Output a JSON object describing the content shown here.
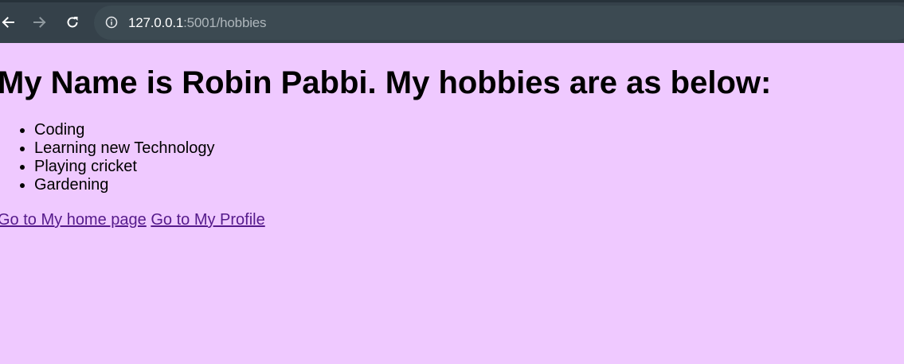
{
  "browser": {
    "url_host": "127.0.0.1",
    "url_rest": ":5001/hobbies"
  },
  "page": {
    "title": "My Name is Robin Pabbi. My hobbies are as below:",
    "hobbies": [
      "Coding",
      "Learning new Technology",
      "Playing cricket",
      "Gardening"
    ],
    "links": {
      "home": "Go to My home page",
      "profile": "Go to My Profile"
    }
  },
  "colors": {
    "page_background": "#efc9ff",
    "browser_toolbar": "#35414a",
    "visited_link": "#551a8b"
  }
}
